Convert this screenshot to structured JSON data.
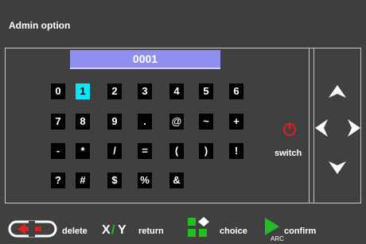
{
  "header": {
    "title": "Admin option"
  },
  "code": {
    "value": "0001"
  },
  "keypad": {
    "rows": [
      [
        "0",
        "1",
        "2",
        "3",
        "4",
        "5",
        "6"
      ],
      [
        "7",
        "8",
        "9",
        ".",
        "@",
        "~",
        "+"
      ],
      [
        "-",
        "*",
        "/",
        "=",
        "(",
        ")",
        "!"
      ],
      [
        "?",
        "#",
        "$",
        "%",
        "&"
      ]
    ],
    "selected": "1"
  },
  "side": {
    "switch_label": "switch"
  },
  "footer": {
    "delete_label": "delete",
    "xy_x": "X",
    "xy_slash": "/",
    "xy_y": "Y",
    "return_label": "return",
    "choice_label": "choice",
    "confirm_label": "confirm",
    "arc_label": "ARC"
  },
  "colors": {
    "background": "#404040",
    "code_box": "#8f8ff0",
    "selected_key": "#00e8ff",
    "power_icon": "#e02020",
    "delete_icon": "#e02020",
    "choice_icon": "#20c020",
    "confirm_icon": "#20c020"
  }
}
